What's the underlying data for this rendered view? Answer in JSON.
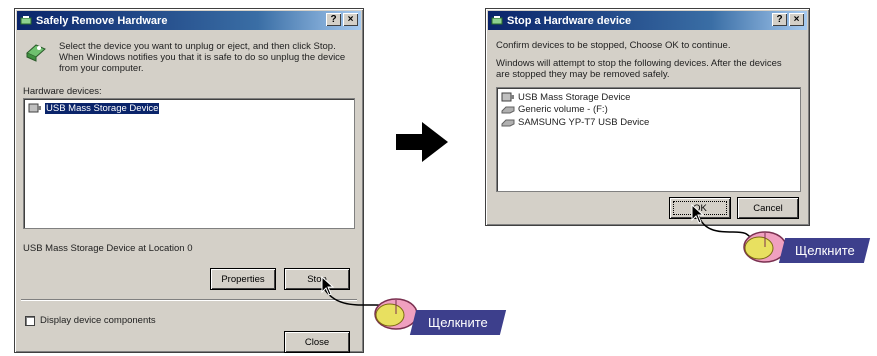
{
  "left_dialog": {
    "title": "Safely Remove Hardware",
    "title_buttons": [
      "?",
      "×"
    ],
    "instruction": "Select the device you want to unplug or eject, and then click Stop. When Windows notifies you that it is safe to do so unplug the device from your computer.",
    "devices_label": "Hardware devices:",
    "devices": [
      {
        "label": "USB Mass Storage Device",
        "selected": true,
        "icon": "usb-device-icon"
      }
    ],
    "status_text": "USB Mass Storage Device at Location 0",
    "properties_label": "Properties",
    "stop_label": "Stop",
    "display_components_label": "Display device components",
    "display_components_checked": false,
    "close_label": "Close"
  },
  "arrow": {
    "icon": "right-arrow-icon"
  },
  "right_dialog": {
    "title": "Stop a Hardware device",
    "title_buttons": [
      "?",
      "×"
    ],
    "confirm_text": "Confirm devices to be stopped, Choose OK to continue.",
    "info_text": "Windows will attempt to stop the following devices. After the devices are stopped they may be removed safely.",
    "devices": [
      {
        "label": "USB Mass Storage Device",
        "icon": "usb-device-icon"
      },
      {
        "label": "Generic volume - (F:)",
        "icon": "drive-icon"
      },
      {
        "label": "SAMSUNG YP-T7 USB Device",
        "icon": "drive-icon"
      }
    ],
    "ok_label": "OK",
    "cancel_label": "Cancel"
  },
  "callouts": {
    "left": "Щелкните",
    "right": "Щелкните"
  },
  "colors": {
    "titlebar": "#0a246a",
    "dialog_bg": "#d4d0c8",
    "callout_bg": "#3d3f8c",
    "mouse_button": "#e8e060",
    "mouse_body": "#f0a0c0"
  }
}
